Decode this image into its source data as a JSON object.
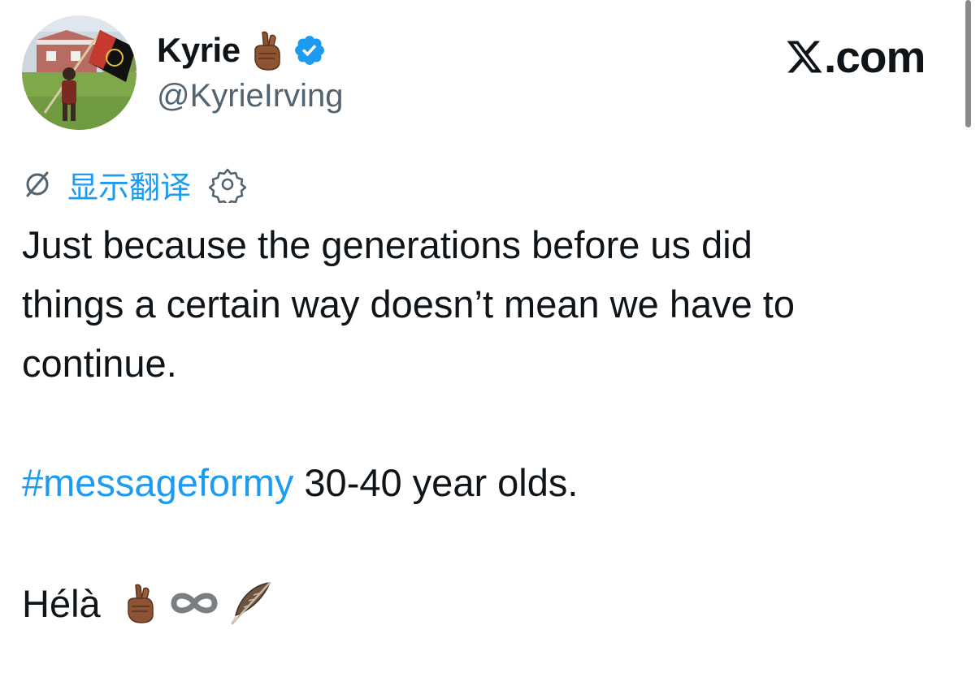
{
  "author": {
    "display_name": "Kyrie",
    "handle": "@KyrieIrving",
    "name_emoji": "crossed-fingers-emoji",
    "verified": true
  },
  "site": {
    "domain": ".com",
    "logo": "x-logo"
  },
  "translate": {
    "label": "显示翻译",
    "icon": "globe-slash-icon",
    "settings_icon": "gear-icon"
  },
  "tweet": {
    "line1": "Just because the generations before us did",
    "line2": "things a certain way doesn’t mean we have to",
    "line3": "continue.",
    "hashtag": "#messageformy",
    "line4_rest": " 30-40 year olds.",
    "signoff": "Hélà",
    "signoff_emojis": [
      "crossed-fingers-emoji",
      "infinity-emoji",
      "feather-emoji"
    ]
  },
  "colors": {
    "accent": "#1d9bf0",
    "text": "#0f1419",
    "secondary": "#536471"
  }
}
